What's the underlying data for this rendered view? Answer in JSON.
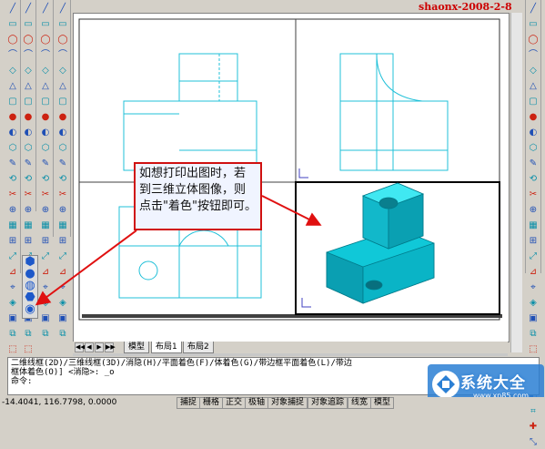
{
  "watermark": "shaonx-2008-2-8",
  "callout": {
    "text": "如想打印出图时，若到三维立体图像，则点击\"着色\"按钮即可。"
  },
  "tabs": {
    "model": "模型",
    "layout1": "布局1",
    "layout2": "布局2",
    "nav": [
      "◀◀",
      "◀",
      "▶",
      "▶▶"
    ]
  },
  "command": {
    "line1": "二维线框(2D)/三维线框(3D)/消隐(H)/平面着色(F)/体着色(G)/带边框平面着色(L)/带边",
    "line2": "框体着色(O)] <消隐>: _o",
    "prompt": "命令:"
  },
  "status": {
    "coords": "-14.4041, 116.7798, 0.0000",
    "buttons": [
      "捕捉",
      "栅格",
      "正交",
      "极轴",
      "对象捕捉",
      "对象追踪",
      "线宽",
      "模型"
    ]
  },
  "logo": {
    "text": "系统大全",
    "url": "www.xp85.com"
  },
  "icons": {
    "col1": [
      "line-icon",
      "xline-icon",
      "polyline-icon",
      "polygon-icon",
      "rectangle-icon",
      "arc-icon",
      "circle-icon",
      "spline-icon",
      "ellipse-icon",
      "insert-block-icon",
      "make-block-icon",
      "point-icon",
      "hatch-icon",
      "region-icon",
      "table-icon",
      "text-icon",
      "dimension-icon",
      "leader-icon",
      "tolerance-icon",
      "center-mark-icon",
      "ucs-icon",
      "view-icon",
      "orbit-icon",
      "wireframe-icon"
    ],
    "col2": [
      "box-icon",
      "sphere-icon",
      "cylinder-icon",
      "cone-icon",
      "wedge-icon",
      "torus-icon",
      "extrude-icon",
      "revolve-icon",
      "slice-icon",
      "section-icon",
      "interfere-icon",
      "setup-drawing-icon",
      "setup-view-icon",
      "setup-profile-icon",
      "union-icon",
      "subtract-icon",
      "intersect-icon",
      "move3d-icon",
      "rotate3d-icon",
      "mirror3d-icon",
      "array3d-icon",
      "align-icon",
      "explode-icon",
      "fillet-icon"
    ],
    "col3": [
      "solid-box-icon",
      "solid-sphere-icon",
      "solid-cylinder-icon",
      "solid-cone-icon",
      "solid-wedge-icon",
      "solid-torus-icon",
      "surface-box-icon",
      "surface-pyramid-icon",
      "surface-wedge-icon",
      "surface-dome-icon",
      "surface-sphere-icon",
      "surface-cone-icon",
      "surface-torus-icon",
      "surface-dish-icon",
      "mesh-icon",
      "revsurf-icon",
      "tabsurf-icon",
      "rulesurf-icon",
      "edgesurf-icon",
      "3dface-icon",
      "edge-icon",
      "3dmesh-icon"
    ],
    "shade": [
      "2d-wireframe-icon",
      "3d-wireframe-icon",
      "hidden-icon",
      "flat-shaded-icon",
      "gouraud-shaded-icon"
    ],
    "right": [
      "line-icon",
      "xline-icon",
      "polyline-icon",
      "polygon-icon",
      "rectangle-icon",
      "arc-icon",
      "circle-icon",
      "revcloud-icon",
      "spline-icon",
      "ellipse-icon",
      "ellipse-arc-icon",
      "insert-icon",
      "block-icon",
      "point-icon",
      "hatch-icon",
      "gradient-icon",
      "region-icon",
      "table-icon",
      "mtext-icon",
      "erase-icon",
      "copy-icon",
      "mirror-icon",
      "offset-icon",
      "array-icon",
      "move-icon",
      "rotate-icon",
      "scale-icon",
      "stretch-icon",
      "trim-icon"
    ]
  }
}
